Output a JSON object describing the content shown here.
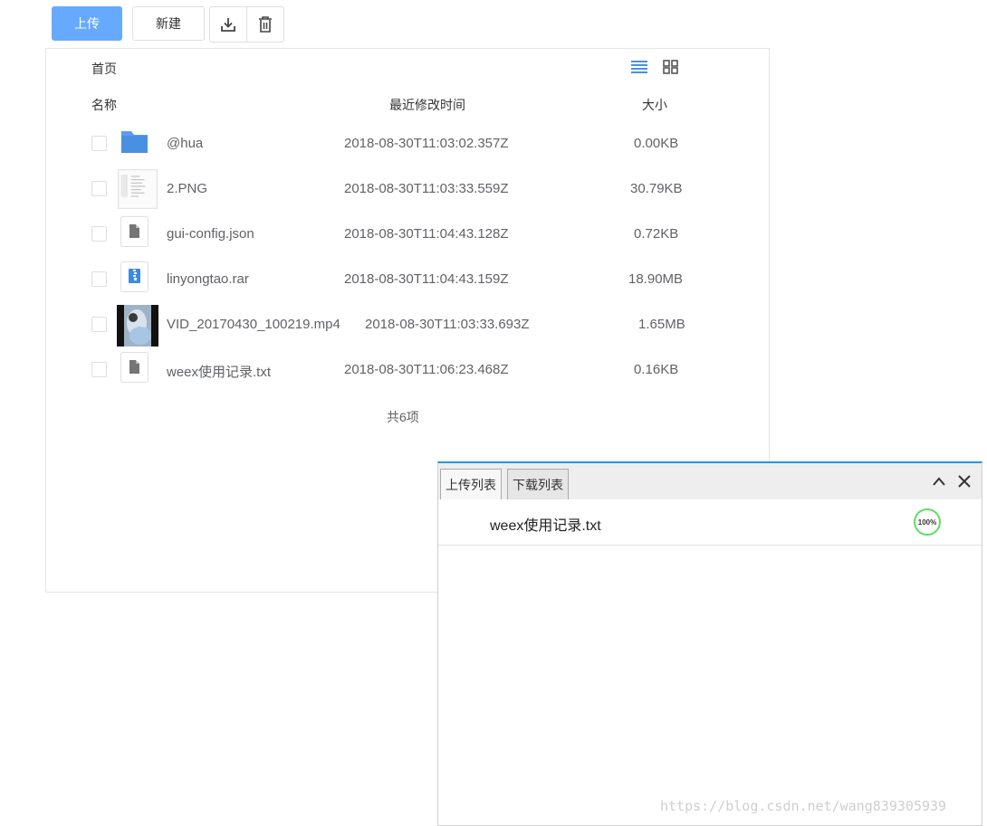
{
  "toolbar": {
    "upload_label": "上传",
    "new_label": "新建",
    "download_icon": "download-icon",
    "delete_icon": "trash-icon"
  },
  "breadcrumb": {
    "home": "首页"
  },
  "view_icons": [
    "list-view-icon",
    "grid-view-icon"
  ],
  "table": {
    "columns": [
      "名称",
      "最近修改时间",
      "大小"
    ],
    "rows": [
      {
        "name": "@hua",
        "modified": "2018-08-30T11:03:02.357Z",
        "size": "0.00KB",
        "icon": "folder-icon"
      },
      {
        "name": "2.PNG",
        "modified": "2018-08-30T11:03:33.559Z",
        "size": "30.79KB",
        "icon": "image-thumbnail"
      },
      {
        "name": "gui-config.json",
        "modified": "2018-08-30T11:04:43.128Z",
        "size": "0.72KB",
        "icon": "file-icon"
      },
      {
        "name": "linyongtao.rar",
        "modified": "2018-08-30T11:04:43.159Z",
        "size": "18.90MB",
        "icon": "archive-icon"
      },
      {
        "name": "VID_20170430_100219.mp4",
        "modified": "2018-08-30T11:03:33.693Z",
        "size": "1.65MB",
        "icon": "video-thumbnail"
      },
      {
        "name": "weex使用记录.txt",
        "modified": "2018-08-30T11:06:23.468Z",
        "size": "0.16KB",
        "icon": "file-icon"
      }
    ],
    "total": "共6项"
  },
  "transfer": {
    "tabs": [
      "上传列表",
      "下载列表"
    ],
    "active_tab": "上传列表",
    "items": [
      {
        "name": "weex使用记录.txt",
        "progress": "100%"
      }
    ],
    "colors": {
      "accent": "#1e9be8",
      "progress": "#5de05d"
    }
  },
  "watermark": "https://blog.csdn.net/wang839305939",
  "colors": {
    "primary": "#66aaff",
    "icon_blue": "#4a90e2"
  }
}
